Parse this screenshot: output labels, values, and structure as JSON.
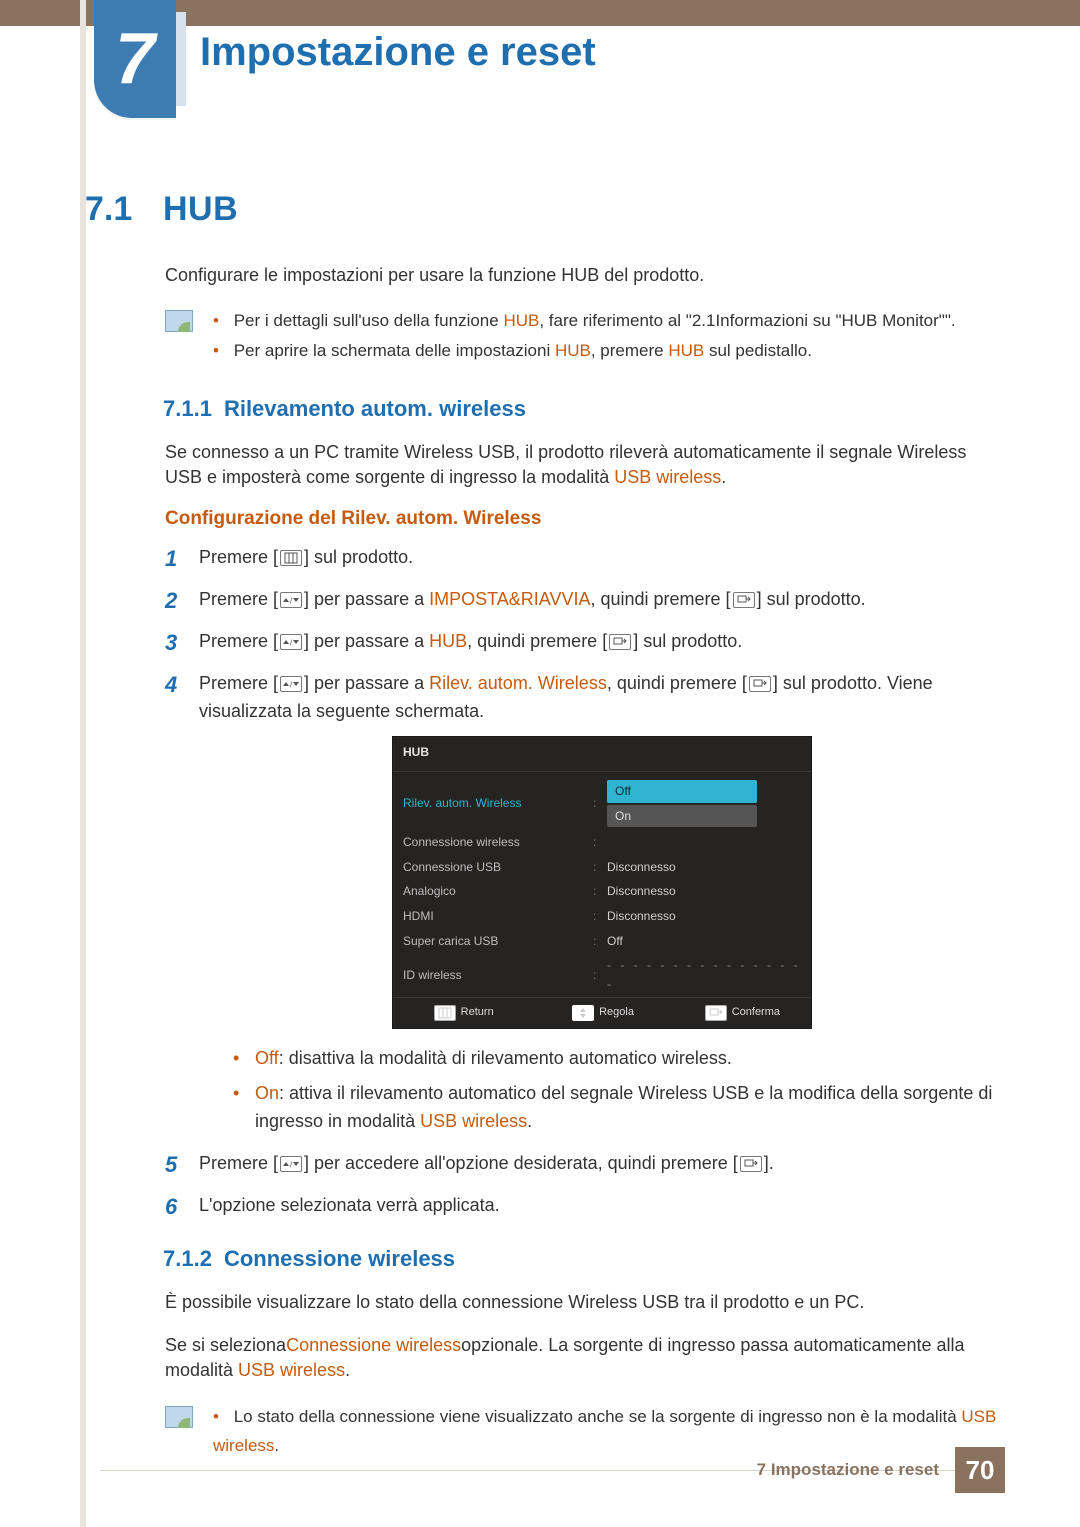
{
  "chapter": {
    "number": "7",
    "title": "Impostazione e reset"
  },
  "section": {
    "number": "7.1",
    "title": "HUB"
  },
  "intro": "Configurare le impostazioni per usare la funzione HUB del prodotto.",
  "note1": {
    "b1_pre": "Per i dettagli sull'uso della funzione ",
    "b1_hub": "HUB",
    "b1_post": ", fare riferimento al \"2.1Informazioni su \"HUB Monitor\"\".",
    "b2_pre": "Per aprire la schermata delle impostazioni ",
    "b2_hub1": "HUB",
    "b2_mid": ", premere ",
    "b2_hub2": "HUB",
    "b2_post": " sul pedistallo."
  },
  "sub711": {
    "number": "7.1.1",
    "title": "Rilevamento autom. wireless",
    "para_pre": "Se connesso a un PC tramite Wireless USB, il prodotto rileverà automaticamente il segnale Wireless USB e imposterà come sorgente di ingresso la modalità ",
    "para_link": "USB wireless",
    "para_post": ".",
    "h4": "Configurazione del Rilev. autom. Wireless",
    "steps": {
      "s1_a": "Premere [",
      "s1_b": "] sul prodotto.",
      "s2_a": "Premere [",
      "s2_b": "] per passare a ",
      "s2_link": "IMPOSTA&RIAVVIA",
      "s2_c": ", quindi premere [",
      "s2_d": "] sul prodotto.",
      "s3_a": "Premere [",
      "s3_b": "] per passare a ",
      "s3_link": "HUB",
      "s3_c": ", quindi premere [",
      "s3_d": "] sul prodotto.",
      "s4_a": "Premere [",
      "s4_b": "] per passare a ",
      "s4_link": "Rilev. autom. Wireless",
      "s4_c": ", quindi premere [",
      "s4_d": "] sul prodotto. Viene visualizzata la seguente schermata.",
      "s5_a": "Premere [",
      "s5_b": "] per accedere all'opzione desiderata, quindi premere [",
      "s5_c": "].",
      "s6": "L'opzione selezionata verrà applicata."
    },
    "bullets": {
      "off_lab": "Off",
      "off_txt": ": disattiva la modalità di rilevamento automatico wireless.",
      "on_lab": "On",
      "on_txt_a": ": attiva il rilevamento automatico del segnale Wireless USB e la modifica della sorgente di ingresso in modalità ",
      "on_link": "USB wireless",
      "on_txt_b": "."
    }
  },
  "osd": {
    "title": "HUB",
    "rows": [
      {
        "label": "Rilev. autom. Wireless",
        "current": true,
        "values": {
          "off": "Off",
          "on": "On"
        }
      },
      {
        "label": "Connessione wireless",
        "value": ""
      },
      {
        "label": "Connessione USB",
        "value": "Disconnesso"
      },
      {
        "label": "Analogico",
        "value": "Disconnesso"
      },
      {
        "label": "HDMI",
        "value": "Disconnesso"
      },
      {
        "label": "Super carica USB",
        "value": "Off"
      },
      {
        "label": "ID wireless",
        "value": "- - - - - - - - - - - - - - - -"
      }
    ],
    "footer": {
      "return": "Return",
      "adjust": "Regola",
      "confirm": "Conferma"
    }
  },
  "sub712": {
    "number": "7.1.2",
    "title": "Connessione wireless",
    "p1": "È possibile visualizzare lo stato della connessione Wireless USB tra il prodotto e un PC.",
    "p2_a": "Se si seleziona",
    "p2_link": "Connessione wireless",
    "p2_b": "opzionale. La sorgente di ingresso passa automaticamente alla modalità ",
    "p2_link2": "USB wireless",
    "p2_c": ".",
    "note_a": "Lo stato della connessione viene visualizzato anche se la sorgente di ingresso non è la modalità ",
    "note_link": "USB wireless",
    "note_b": "."
  },
  "footer": {
    "chapter_label": "7 Impostazione e reset",
    "page": "70"
  }
}
